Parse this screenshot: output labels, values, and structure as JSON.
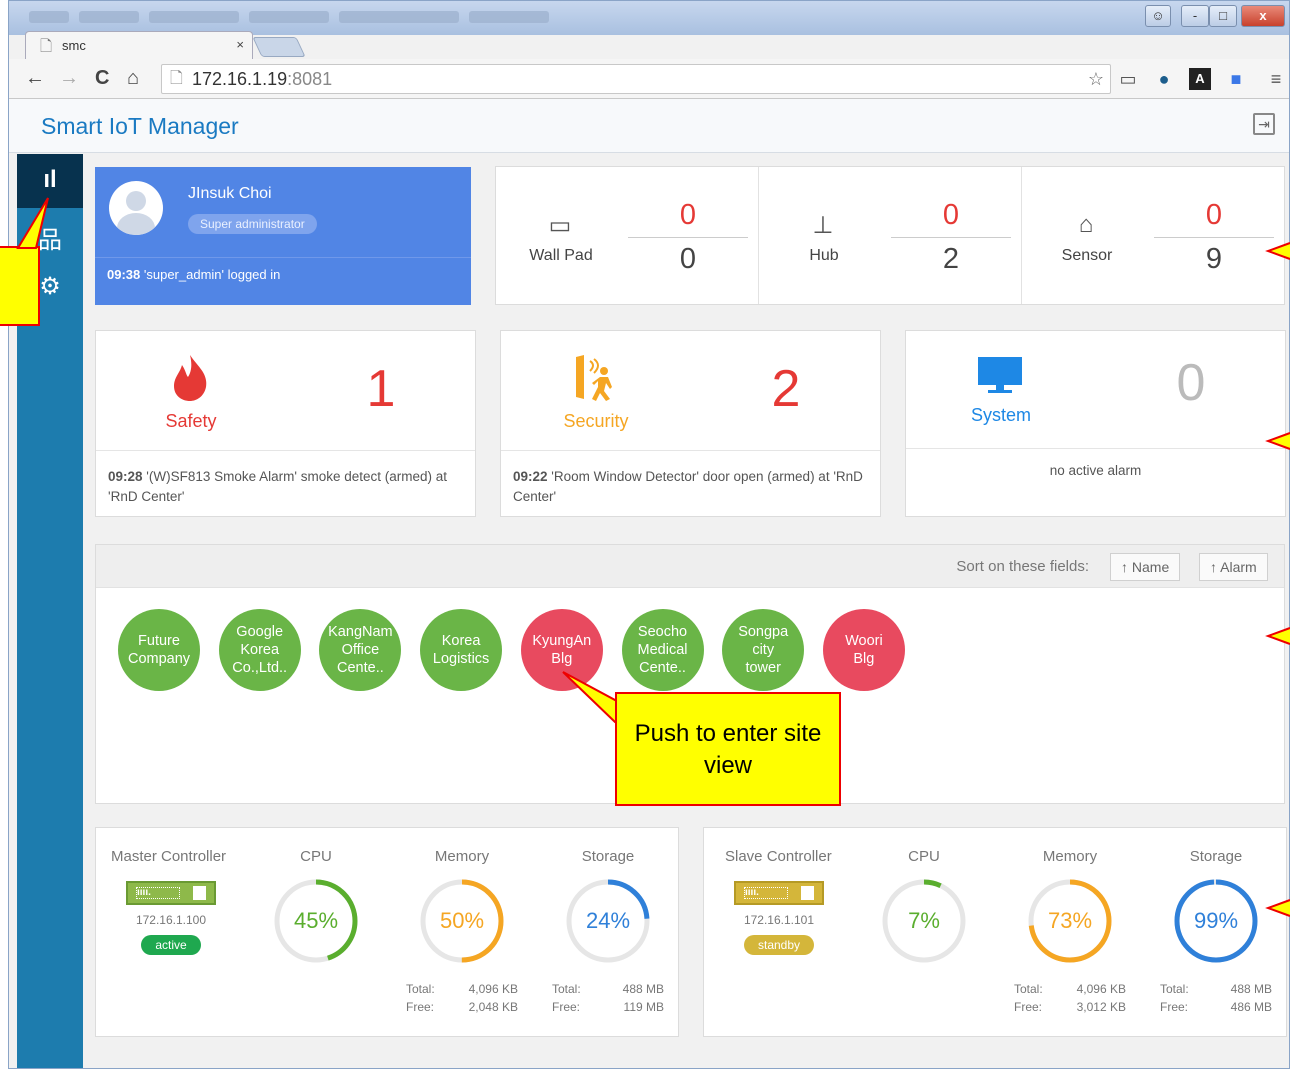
{
  "browser": {
    "tab_title": "smc",
    "tab_close": "×",
    "url_host": "172.16.1.19",
    "url_port": ":8081",
    "window_buttons": [
      "-",
      "□",
      "x"
    ]
  },
  "app": {
    "title": "Smart IoT Manager"
  },
  "profile": {
    "name": "JInsuk Choi",
    "role": "Super administrator",
    "log_time": "09:38",
    "log_text": "'super_admin' logged in"
  },
  "devices": [
    {
      "label": "Wall Pad",
      "top": "0",
      "bottom": "0",
      "icon": "wall-pad-icon"
    },
    {
      "label": "Hub",
      "top": "0",
      "bottom": "2",
      "icon": "hub-icon"
    },
    {
      "label": "Sensor",
      "top": "0",
      "bottom": "9",
      "icon": "sensor-icon"
    }
  ],
  "alarms": {
    "safety": {
      "label": "Safety",
      "count": "1",
      "time": "09:28",
      "message": "'(W)SF813 Smoke Alarm' smoke detect (armed) at 'RnD Center'",
      "color": "#e53935"
    },
    "security": {
      "label": "Security",
      "count": "2",
      "time": "09:22",
      "message": "'Room Window Detector' door open (armed) at 'RnD Center'",
      "color": "#f5a623"
    },
    "system": {
      "label": "System",
      "count": "0",
      "message": "no active alarm",
      "color": "#1e88e5"
    }
  },
  "sites": {
    "sort_label": "Sort on these fields:",
    "sort_name": "↑ Name",
    "sort_alarm": "↑ Alarm",
    "items": [
      {
        "name": "Future\nCompany",
        "status": "ok"
      },
      {
        "name": "Google\nKorea\nCo.,Ltd..",
        "status": "ok"
      },
      {
        "name": "KangNam\nOffice\nCente..",
        "status": "ok"
      },
      {
        "name": "Korea\nLogistics",
        "status": "ok"
      },
      {
        "name": "KyungAn\nBlg",
        "status": "alarm"
      },
      {
        "name": "Seocho\nMedical\nCente..",
        "status": "ok"
      },
      {
        "name": "Songpa\ncity\ntower",
        "status": "ok"
      },
      {
        "name": "Woori\nBlg",
        "status": "alarm"
      }
    ],
    "colors": {
      "ok": "#6ab547",
      "alarm": "#e84a5f"
    }
  },
  "callouts": {
    "site_view": "Push to enter site view"
  },
  "controllers": {
    "master": {
      "title": "Master Controller",
      "ip": "172.16.1.100",
      "state": "active",
      "state_color": "#1fa84f",
      "cpu": {
        "label": "CPU",
        "value": 45,
        "text": "45%",
        "color": "#5aae2e"
      },
      "memory": {
        "label": "Memory",
        "value": 50,
        "text": "50%",
        "color": "#f5a623",
        "total_label": "Total:",
        "total": "4,096 KB",
        "free_label": "Free:",
        "free": "2,048 KB"
      },
      "storage": {
        "label": "Storage",
        "value": 24,
        "text": "24%",
        "color": "#2f80d9",
        "total_label": "Total:",
        "total": "488 MB",
        "free_label": "Free:",
        "free": "119 MB"
      }
    },
    "slave": {
      "title": "Slave Controller",
      "ip": "172.16.1.101",
      "state": "standby",
      "state_color": "#d4b63a",
      "cpu": {
        "label": "CPU",
        "value": 7,
        "text": "7%",
        "color": "#5aae2e"
      },
      "memory": {
        "label": "Memory",
        "value": 73,
        "text": "73%",
        "color": "#f5a623",
        "total_label": "Total:",
        "total": "4,096 KB",
        "free_label": "Free:",
        "free": "3,012 KB"
      },
      "storage": {
        "label": "Storage",
        "value": 99,
        "text": "99%",
        "color": "#2f80d9",
        "total_label": "Total:",
        "total": "488 MB",
        "free_label": "Free:",
        "free": "486 MB"
      }
    }
  }
}
